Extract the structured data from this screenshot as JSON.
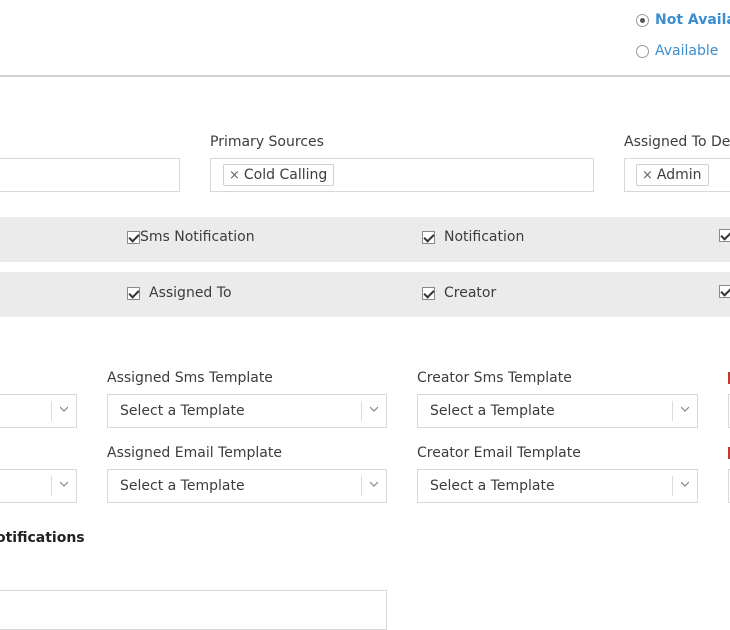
{
  "availability": {
    "options": [
      {
        "label": "Not Available",
        "selected": true
      },
      {
        "label": "Available",
        "selected": false
      }
    ]
  },
  "filters": {
    "primary_sources": {
      "label": "Primary Sources",
      "tags": [
        "Cold Calling"
      ]
    },
    "assigned_to": {
      "label": "Assigned To Des",
      "tags": [
        "Admin"
      ]
    }
  },
  "notification_checks": {
    "row1": [
      "Sms Notification",
      "Notification"
    ],
    "row2": [
      "Assigned To",
      "Creator"
    ]
  },
  "templates": {
    "assigned_sms": {
      "label": "Assigned Sms Template",
      "value": "Select a Template"
    },
    "creator_sms": {
      "label": "Creator Sms Template",
      "value": "Select a Template"
    },
    "assigned_email": {
      "label": "Assigned Email Template",
      "value": "Select a Template"
    },
    "creator_email": {
      "label": "Creator Email Template",
      "value": "Select a Template"
    }
  },
  "section": {
    "title": "otifications"
  }
}
